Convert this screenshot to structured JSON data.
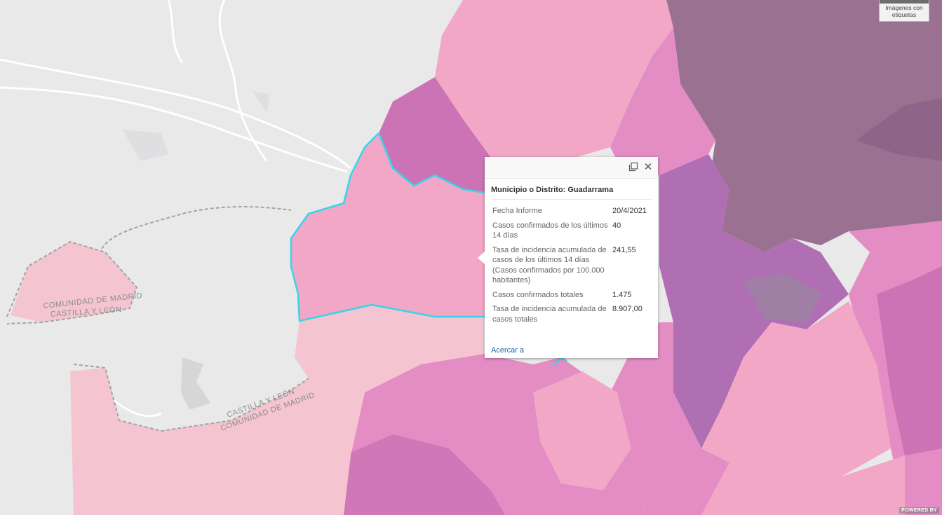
{
  "map": {
    "labels": {
      "border_north_1": "COMUNIDAD DE MADRID",
      "border_north_2": "CASTILLA Y LEÓN",
      "border_south_1": "CASTILLA Y LEÓN",
      "border_south_2": "COMUNIDAD DE MADRID"
    },
    "colors": {
      "background": "#e9e9ea",
      "lightest_pink": "#f4c4d0",
      "light_pink": "#f1a7c5",
      "medium_pink": "#e48cc4",
      "magenta": "#cc73b6",
      "purple": "#b06fb3",
      "dark_mauve": "#9a7191",
      "selection_outline": "#37d4ec"
    }
  },
  "popup": {
    "title": "Municipio o Distrito: Guadarrama",
    "maximize_icon": "maximize-icon",
    "close_icon": "close-icon",
    "rows": [
      {
        "label": "Fecha Informe",
        "value": "20/4/2021"
      },
      {
        "label": "Casos confirmados de los últimos 14 días",
        "value": "40"
      },
      {
        "label": "Tasa de incidencia acumulada de casos de los últimos 14 días (Casos confirmados por 100.000 habitantes)",
        "value": "241,55"
      },
      {
        "label": "Casos confirmados totales",
        "value": "1.475"
      },
      {
        "label": "Tasa de incidencia acumulada de casos totales",
        "value": "8.907,00"
      }
    ],
    "zoom_link": "Acercar a"
  },
  "basemap_toggle": {
    "label": "Imágenes con etiquetas"
  },
  "attribution": "POWERED BY"
}
